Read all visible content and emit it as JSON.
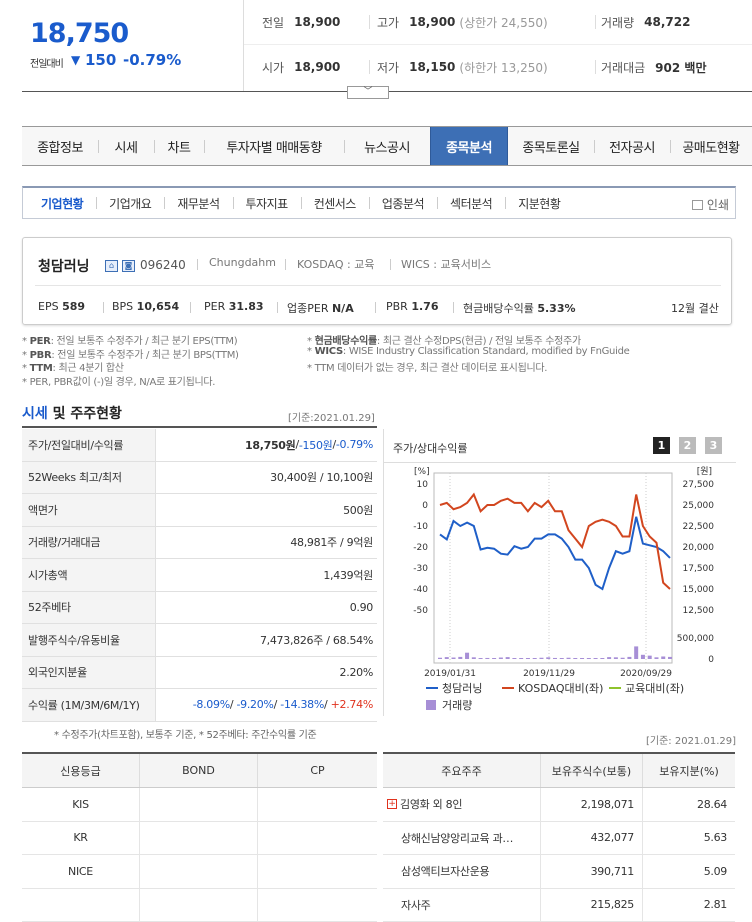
{
  "quote": {
    "price": "18,750",
    "change_label": "전일대비",
    "change_arrow": "▼",
    "change_value": "150",
    "change_rate": "-0.79%",
    "prev_close": {
      "label": "전일",
      "value": "18,900"
    },
    "high": {
      "label": "고가",
      "value": "18,900",
      "sub": "(상한가 24,550)"
    },
    "volume": {
      "label": "거래량",
      "value": "48,722"
    },
    "open": {
      "label": "시가",
      "value": "18,900"
    },
    "low": {
      "label": "저가",
      "value": "18,150",
      "sub": "(하한가 13,250)"
    },
    "trade_value": {
      "label": "거래대금",
      "value": "902 백만"
    },
    "toggle_icon": "chevron-down-icon"
  },
  "main_tabs": [
    "종합정보",
    "시세",
    "차트",
    "투자자별 매매동향",
    "뉴스공시",
    "종목분석",
    "종목토론실",
    "전자공시",
    "공매도현황"
  ],
  "main_tab_active": 5,
  "sub_tabs": [
    "기업현황",
    "기업개요",
    "재무분석",
    "투자지표",
    "컨센서스",
    "업종분석",
    "섹터분석",
    "지분현황"
  ],
  "sub_tab_active": 0,
  "print_label": "인쇄",
  "company": {
    "name": "청담러닝",
    "code": "096240",
    "eng_name": "Chungdahm",
    "market": "KOSDAQ : 교육",
    "wics": "WICS : 교육서비스",
    "metrics": {
      "eps_label": "EPS",
      "eps": "589",
      "bps_label": "BPS",
      "bps": "10,654",
      "per_label": "PER",
      "per": "31.83",
      "ind_per_label": "업종PER",
      "ind_per": "N/A",
      "pbr_label": "PBR",
      "pbr": "1.76",
      "div_label": "현금배당수익률",
      "div": "5.33%",
      "settle": "12월 결산"
    }
  },
  "notes": {
    "per_k": "PER",
    "per_t": ": 전일 보통주 수정주가 / 최근 분기 EPS(TTM)",
    "pbr_k": "PBR",
    "pbr_t": ": 전일 보통주 수정주가 / 최근 분기 BPS(TTM)",
    "ttm_k": "TTM",
    "ttm_t": ": 최근 4분기 합산",
    "neg": "* PER, PBR값이 (-)일 경우, N/A로 표기됩니다.",
    "div_k": "현금배당수익률",
    "div_t": ": 최근 결산 수정DPS(현금) / 전일 보통주 수정주가",
    "wics_k": "WICS",
    "wics_t": ": WISE Industry Classification Standard, modified by FnGuide",
    "ttm_none": "* TTM 데이터가 없는 경우, 최근 결산 데이터로 표시됩니다."
  },
  "section": {
    "title_a": "시세",
    "title_b": " 및 주주현황",
    "base_date": "[기준:2021.01.29]",
    "base_date_2": "[기준: 2021.01.29]"
  },
  "stats": [
    {
      "k": "주가/전일대비/수익률",
      "v_main": "18,750원",
      "v_sep": " / ",
      "v_b": "-150원",
      "v_sep2": " / ",
      "v_c": "-0.79%"
    },
    {
      "k": "52Weeks 최고/최저",
      "v": "30,400원 / 10,100원"
    },
    {
      "k": "액면가",
      "v": "500원"
    },
    {
      "k": "거래량/거래대금",
      "v": "48,981주 / 9억원"
    },
    {
      "k": "시가총액",
      "v": "1,439억원"
    },
    {
      "k": "52주베타",
      "v": "0.90"
    },
    {
      "k": "발행주식수/유동비율",
      "v": "7,473,826주 / 68.54%"
    },
    {
      "k": "외국인지분율",
      "v": "2.20%"
    },
    {
      "k": "수익률 (1M/3M/6M/1Y)",
      "r1": "-8.09%",
      "r2": "-9.20%",
      "r3": "-14.38%",
      "r4": "+2.74%"
    }
  ],
  "stat_note": "* 수정주가(차트포함), 보통주 기준, * 52주베타: 주간수익률 기준",
  "chart_panel": {
    "title": "주가/상대수익률",
    "buttons": [
      "1",
      "2",
      "3"
    ]
  },
  "chart_data": {
    "type": "line",
    "left_axis_unit": "[%]",
    "right_axis_unit": "[원]",
    "left_ticks": [
      10,
      0,
      -10,
      -20,
      -30,
      -40,
      -50
    ],
    "left_ylim": [
      -50,
      10
    ],
    "right_ticks": [
      "27,500",
      "25,000",
      "22,500",
      "20,000",
      "17,500",
      "15,000",
      "12,500"
    ],
    "right_ylim": [
      12500,
      27500
    ],
    "volume_ticks": [
      "500,000",
      "0"
    ],
    "x_ticks": [
      "2019/01/31",
      "2019/11/29",
      "2020/09/29"
    ],
    "series": [
      {
        "name": "청담러닝",
        "color": "#1f5fc8",
        "axis": "right",
        "values": [
          21500,
          20900,
          23100,
          22500,
          22900,
          22500,
          19700,
          19900,
          19800,
          19200,
          19100,
          20100,
          19800,
          20000,
          21000,
          21000,
          21500,
          21500,
          21000,
          20000,
          18500,
          18500,
          17500,
          15500,
          15000,
          17500,
          19500,
          19200,
          19500,
          23600,
          20400,
          20200,
          20000,
          19500,
          18700
        ]
      },
      {
        "name": "KOSDAQ대비(좌)",
        "color": "#d2461f",
        "axis": "left",
        "values": [
          0,
          1,
          -2,
          -1,
          1,
          5,
          -3,
          0,
          0,
          2,
          3,
          1,
          1,
          -3,
          1,
          -1,
          2,
          -3,
          -3,
          -12,
          -16,
          -20,
          -10,
          -8,
          -7,
          -8,
          -10,
          -15,
          -15,
          5,
          -10,
          -15,
          -18,
          -37,
          -40
        ]
      },
      {
        "name": "교육대비(좌)",
        "color": "#8ec32c",
        "axis": "left",
        "values": []
      }
    ],
    "volume_name": "거래량",
    "volume_color": "#a78fd6",
    "volume": [
      30000,
      45000,
      35000,
      50000,
      150000,
      40000,
      20000,
      25000,
      10000,
      35000,
      45000,
      20000,
      20000,
      15000,
      20000,
      30000,
      40000,
      25000,
      15000,
      30000,
      15000,
      10000,
      10000,
      15000,
      20000,
      45000,
      40000,
      30000,
      50000,
      300000,
      100000,
      80000,
      40000,
      60000,
      50000
    ]
  },
  "credit_table": {
    "headers": [
      "신용등급",
      "BOND",
      "CP"
    ],
    "rows": [
      [
        "KIS",
        "",
        ""
      ],
      [
        "KR",
        "",
        ""
      ],
      [
        "NICE",
        "",
        ""
      ],
      [
        "",
        "",
        ""
      ]
    ]
  },
  "holders_table": {
    "headers": [
      "주요주주",
      "보유주식수(보통)",
      "보유지분(%)"
    ],
    "rows": [
      {
        "name": "김영화 외 8인",
        "expand": true,
        "shares": "2,198,071",
        "pct": "28.64"
      },
      {
        "name": "상해신남양앙리교육 과…",
        "expand": false,
        "shares": "432,077",
        "pct": "5.63"
      },
      {
        "name": "삼성액티브자산운용",
        "expand": false,
        "shares": "390,711",
        "pct": "5.09"
      },
      {
        "name": "자사주",
        "expand": false,
        "shares": "215,825",
        "pct": "2.81"
      }
    ]
  }
}
